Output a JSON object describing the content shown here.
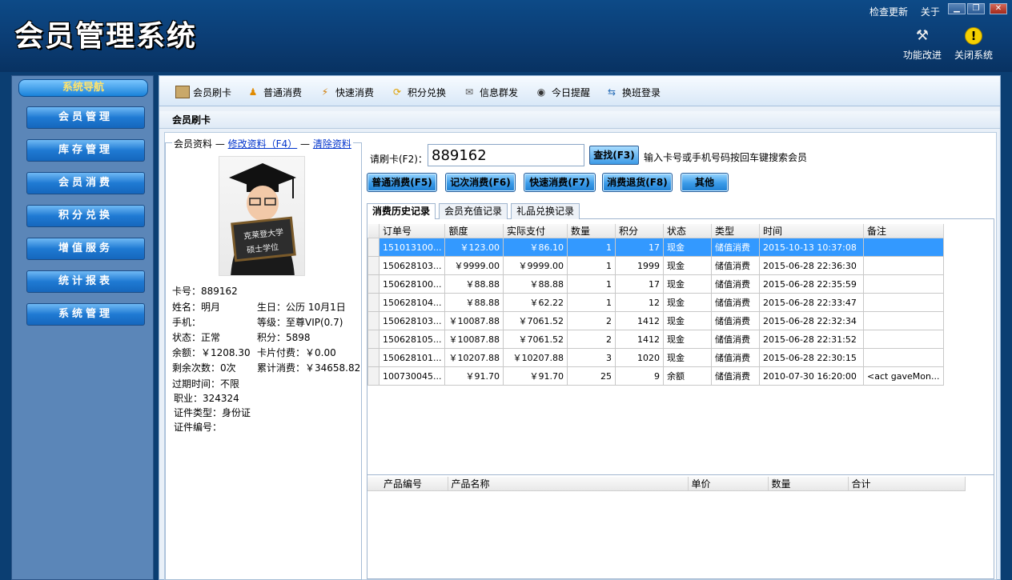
{
  "app": {
    "title": "会员管理系统",
    "check_update": "检查更新",
    "about": "关于",
    "minimize": "▁",
    "maximize": "❐",
    "close": "✕",
    "tool_improve": "功能改进",
    "tool_close_system": "关闭系统"
  },
  "sidebar": {
    "title": "系统导航",
    "items": [
      {
        "label": "会员管理"
      },
      {
        "label": "库存管理"
      },
      {
        "label": "会员消费"
      },
      {
        "label": "积分兑换"
      },
      {
        "label": "增值服务"
      },
      {
        "label": "统计报表"
      },
      {
        "label": "系统管理"
      }
    ]
  },
  "toolbar": {
    "items": [
      {
        "label": "会员刷卡",
        "icon": "card-icon"
      },
      {
        "label": "普通消费",
        "icon": "person-icon"
      },
      {
        "label": "快速消费",
        "icon": "fast-icon"
      },
      {
        "label": "积分兑换",
        "icon": "exchange-icon"
      },
      {
        "label": "信息群发",
        "icon": "mail-icon"
      },
      {
        "label": "今日提醒",
        "icon": "clock-icon"
      },
      {
        "label": "换班登录",
        "icon": "shift-icon"
      }
    ]
  },
  "page": {
    "title": "会员刷卡"
  },
  "member": {
    "legend": "会员资料",
    "edit_link": "修改资料（F4）",
    "clear_link": "清除资料",
    "photo_text_1": "克莱登大学",
    "photo_text_2": "硕士学位",
    "card_no": "卡号：889162",
    "name": "姓名：明月",
    "birthday": "生日：公历 10月1日",
    "phone": "手机：",
    "level": "等级：至尊VIP(0.7)",
    "status": "状态：正常",
    "points": "积分：5898",
    "balance": "余额：￥1208.30",
    "card_fee": "卡片付费：￥0.00",
    "remain_times": "剩余次数：0次",
    "total_spent": "累计消费：￥34658.82",
    "expire": "过期时间：不限",
    "job": "职业：324324",
    "id_type": "证件类型：身份证",
    "id_no": "证件编号："
  },
  "search": {
    "label": "请刷卡(F2)：",
    "value": "889162",
    "find_button": "查找(F3)",
    "hint": "输入卡号或手机号码按回车键搜索会员"
  },
  "actions": [
    {
      "label": "普通消费(F5)"
    },
    {
      "label": "记次消费(F6)"
    },
    {
      "label": "快速消费(F7)"
    },
    {
      "label": "消费退货(F8)"
    },
    {
      "label": "其他"
    }
  ],
  "tabs": [
    {
      "label": "消费历史记录"
    },
    {
      "label": "会员充值记录"
    },
    {
      "label": "礼品兑换记录"
    }
  ],
  "history": {
    "columns": [
      "订单号",
      "额度",
      "实际支付",
      "数量",
      "积分",
      "状态",
      "类型",
      "时间",
      "备注"
    ],
    "rows": [
      [
        "151013100...",
        "￥123.00",
        "￥86.10",
        "1",
        "17",
        "现金",
        "储值消费",
        "2015-10-13 10:37:08",
        ""
      ],
      [
        "150628103...",
        "￥9999.00",
        "￥9999.00",
        "1",
        "1999",
        "现金",
        "储值消费",
        "2015-06-28 22:36:30",
        ""
      ],
      [
        "150628100...",
        "￥88.88",
        "￥88.88",
        "1",
        "17",
        "现金",
        "储值消费",
        "2015-06-28 22:35:59",
        ""
      ],
      [
        "150628104...",
        "￥88.88",
        "￥62.22",
        "1",
        "12",
        "现金",
        "储值消费",
        "2015-06-28 22:33:47",
        ""
      ],
      [
        "150628103...",
        "￥10087.88",
        "￥7061.52",
        "2",
        "1412",
        "现金",
        "储值消费",
        "2015-06-28 22:32:34",
        ""
      ],
      [
        "150628105...",
        "￥10087.88",
        "￥7061.52",
        "2",
        "1412",
        "现金",
        "储值消费",
        "2015-06-28 22:31:52",
        ""
      ],
      [
        "150628101...",
        "￥10207.88",
        "￥10207.88",
        "3",
        "1020",
        "现金",
        "储值消费",
        "2015-06-28 22:30:15",
        ""
      ],
      [
        "100730045...",
        "￥91.70",
        "￥91.70",
        "25",
        "9",
        "余额",
        "储值消费",
        "2010-07-30 16:20:00",
        "<act gaveMon..."
      ]
    ]
  },
  "detail": {
    "columns": [
      "产品编号",
      "产品名称",
      "单价",
      "数量",
      "合计"
    ]
  },
  "colors": {
    "accent": "#1f7ad3",
    "selected_row": "#3399ff",
    "bg": "#0b3e72"
  }
}
